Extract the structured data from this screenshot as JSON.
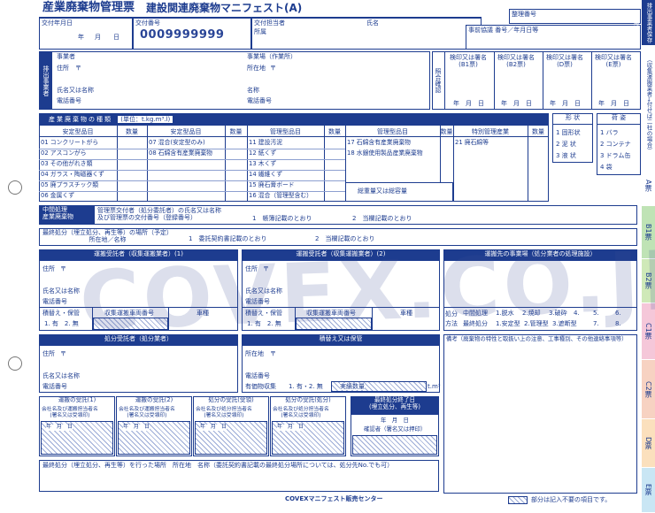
{
  "title": "産業廃棄物管理票",
  "subtitle": "建設関連廃棄物マニフェスト(A)",
  "top": {
    "issue_date": "交付年月日",
    "year": "年",
    "month": "月",
    "day": "日",
    "issue_no": "交付番号",
    "issue_no_value": "0009999999",
    "issuer": "交付担当者",
    "office": "所属",
    "name": "氏名",
    "seiri": "整理番号",
    "jizen": "事前協議 番号／年月日等"
  },
  "emitter": {
    "side": "排出事業者",
    "company": "事業者",
    "address": "住所",
    "postal": "〒",
    "name": "氏名又は名称",
    "tel": "電話番号",
    "site": "事業場（作業所）",
    "location": "所在地",
    "site_name": "名称",
    "site_tel": "電話番号"
  },
  "confirm": {
    "side": "照合確認",
    "cols": [
      "検印又は署名\n(B1票)",
      "検印又は署名\n(B2票)",
      "検印又は署名\n(D票)",
      "検印又は署名\n(E票)"
    ],
    "date": "年　月　日"
  },
  "waste": {
    "title": "産業廃棄物の種類",
    "unit": "(単位：t.kg.m³.l)",
    "col_headers": [
      "安定型品目",
      "数量",
      "安定型品目",
      "数量",
      "管理型品目",
      "数量",
      "管理型品目",
      "数量",
      "特別管理産業",
      "数量"
    ],
    "col1": [
      "01 コンクリートがら",
      "02 アスコンがら",
      "03 その他がれき類",
      "04 ガラス・陶磁器くず",
      "05 廃プラスチック類",
      "06 金属くず"
    ],
    "col2": [
      "07 混合(安定型のみ)",
      "08 石綿含有産業廃棄物"
    ],
    "col3": [
      "11 建設汚泥",
      "12 紙くず",
      "13 木くず",
      "14 繊維くず",
      "15 廃石膏ボード",
      "16 混合（管理型含む）"
    ],
    "col4": [
      "17 石綿含有産業廃棄物",
      "18 水銀使用製品産業廃棄物"
    ],
    "col5": [
      "21 廃石綿等"
    ],
    "total": "総重量又は総容量",
    "shape_title": "形 状",
    "shape": [
      "1 固形状",
      "2 泥 状",
      "3 液 状"
    ],
    "pack_title": "荷 姿",
    "pack": [
      "1 バラ",
      "2 コンテナ",
      "3 ドラム缶",
      "4 袋"
    ]
  },
  "middle": {
    "label": "中間処理\n産業廃棄物",
    "desc": "管理票交付者（処分委託者）の氏名又は名称\n及び管理票の交付番号（登録番号）",
    "opt1": "1　帳簿記載のとおり",
    "opt2": "2　当欄記載のとおり"
  },
  "final": {
    "label": "最終処分（埋立処分、再生等）の場所（予定）\n所在地／名称",
    "opt1": "1　委託契約書記載のとおり",
    "opt2": "2　当欄記載のとおり"
  },
  "trans1": {
    "title": "運搬受託者（収集運搬業者）(1)",
    "address": "住所",
    "postal": "〒",
    "name": "氏名又は名称",
    "tel": "電話番号",
    "reload": "積替え・保管",
    "vehicle_no": "収集運搬車両番号",
    "vehicle": "車種",
    "yes_no": "1. 有　2. 無"
  },
  "trans2": {
    "title": "運搬受託者（収集運搬業者）(2)",
    "address": "住所",
    "postal": "〒",
    "name": "氏名又は名称",
    "tel": "電話番号",
    "reload": "積替え・保管",
    "vehicle_no": "収集運搬車両番号",
    "vehicle": "車種",
    "yes_no": "1. 有　2. 無"
  },
  "dest": {
    "title": "運搬先の事業場（処分業者の処理施設）",
    "method": "処分方法",
    "mid": "中間処理",
    "fin": "最終処分",
    "m1": "1.脱水",
    "m2": "2.焼却",
    "m3": "3.破砕",
    "m4": "4.",
    "m5": "5.",
    "m6": "6.",
    "m7": "1.安定型",
    "m8": "2.管理型",
    "m9": "3.遮断型",
    "m10": "7.",
    "m11": "8."
  },
  "disposer": {
    "title": "処分受託者（処分業者）",
    "address": "住所",
    "postal": "〒",
    "name": "氏名又は名称",
    "tel": "電話番号"
  },
  "storage": {
    "title": "積替え又は保管",
    "location": "所在地",
    "postal": "〒",
    "tel": "電話番号",
    "valuables": "有価物収集",
    "yn": "1. 有・2. 無",
    "actual": "実績数量",
    "unit": "t.m³"
  },
  "remarks": "備考（廃棄物の特性と取扱い上の注意、工事種別、その他連絡事項等）",
  "receipt": {
    "r1": "運搬の受託(1)",
    "r2": "運搬の受託(2)",
    "r3": "処分の受託(受領)",
    "r4": "処分の受託(処分)",
    "r5": "最終処分終了日\n(埋立処分、再生等)",
    "sub1": "会社名及び運搬担当者名\n(署名又は受領印)",
    "sub2": "会社名及び運搬担当者名\n(署名又は受領印)",
    "sub3": "会社名及び処分担当者名\n(署名又は受領印)",
    "sub4": "会社名及び処分担当者名\n(署名又は受領印)",
    "date": "年　月　日",
    "confirm": "確認者（署名又は押印）"
  },
  "final_bottom": "最終処分（埋立処分、再生等）を行った場所　所在地　名称（委託契約書記載の最終処分場所については、処分先No.でも可）",
  "footer": "COVEXマニフェスト販売センター",
  "footer_note": "部分は記入不要の項目です。",
  "side_strips": [
    {
      "label": "排出事業者保存用",
      "color": "#1d3c8f",
      "text": "#fff"
    },
    {
      "label": "（収集運搬業者→付せば二社の場合）",
      "color": "#ffffff",
      "text": "#1d3c8f"
    },
    {
      "label": "A票",
      "color": "#ffffff",
      "text": "#1d3c8f"
    },
    {
      "label": "B1票",
      "color": "#bfe3b5",
      "text": "#1d3c8f"
    },
    {
      "label": "B2票",
      "color": "#cfe9b8",
      "text": "#1d3c8f"
    },
    {
      "label": "C1票",
      "color": "#f5c7d9",
      "text": "#1d3c8f"
    },
    {
      "label": "C2票",
      "color": "#f7d2c2",
      "text": "#1d3c8f"
    },
    {
      "label": "D票",
      "color": "#fbe0bd",
      "text": "#1d3c8f"
    },
    {
      "label": "E票",
      "color": "#c9e6f4",
      "text": "#1d3c8f"
    }
  ],
  "watermark": "COVEX.CO.JP"
}
